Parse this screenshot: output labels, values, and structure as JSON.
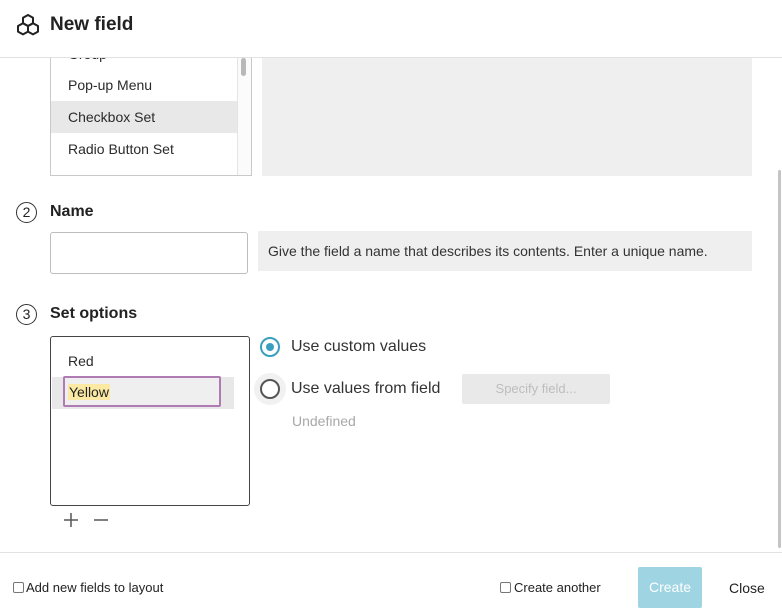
{
  "window": {
    "title": "New field",
    "logo_icon": "cubes-icon"
  },
  "field_types": {
    "items": [
      {
        "label": "Group"
      },
      {
        "label": "Pop-up Menu"
      },
      {
        "label": "Checkbox Set",
        "selected": true
      },
      {
        "label": "Radio Button Set"
      }
    ]
  },
  "sections": {
    "name": {
      "step": "2",
      "label": "Name",
      "value": "",
      "help": "Give the field a name that describes its contents. Enter a unique name."
    },
    "set_options": {
      "step": "3",
      "label": "Set options",
      "options": [
        "Red"
      ],
      "editing_value": "Yellow",
      "add_icon": "plus-icon",
      "remove_icon": "minus-icon",
      "custom_values_label": "Use custom values",
      "custom_values_selected": true,
      "values_from_field_label": "Use values from field",
      "values_from_field_selected": false,
      "specify_field_label": "Specify field...",
      "undefined_label": "Undefined"
    }
  },
  "footer": {
    "add_to_layout_label": "Add new fields to layout",
    "add_to_layout_checked": false,
    "create_another_label": "Create another",
    "create_another_checked": false,
    "create_label": "Create",
    "close_label": "Close"
  },
  "colors": {
    "accent": "#3a9fbf",
    "create_button": "#9fd4e2",
    "edit_border": "#b07ab3",
    "text_highlight": "#fbe9a4"
  }
}
